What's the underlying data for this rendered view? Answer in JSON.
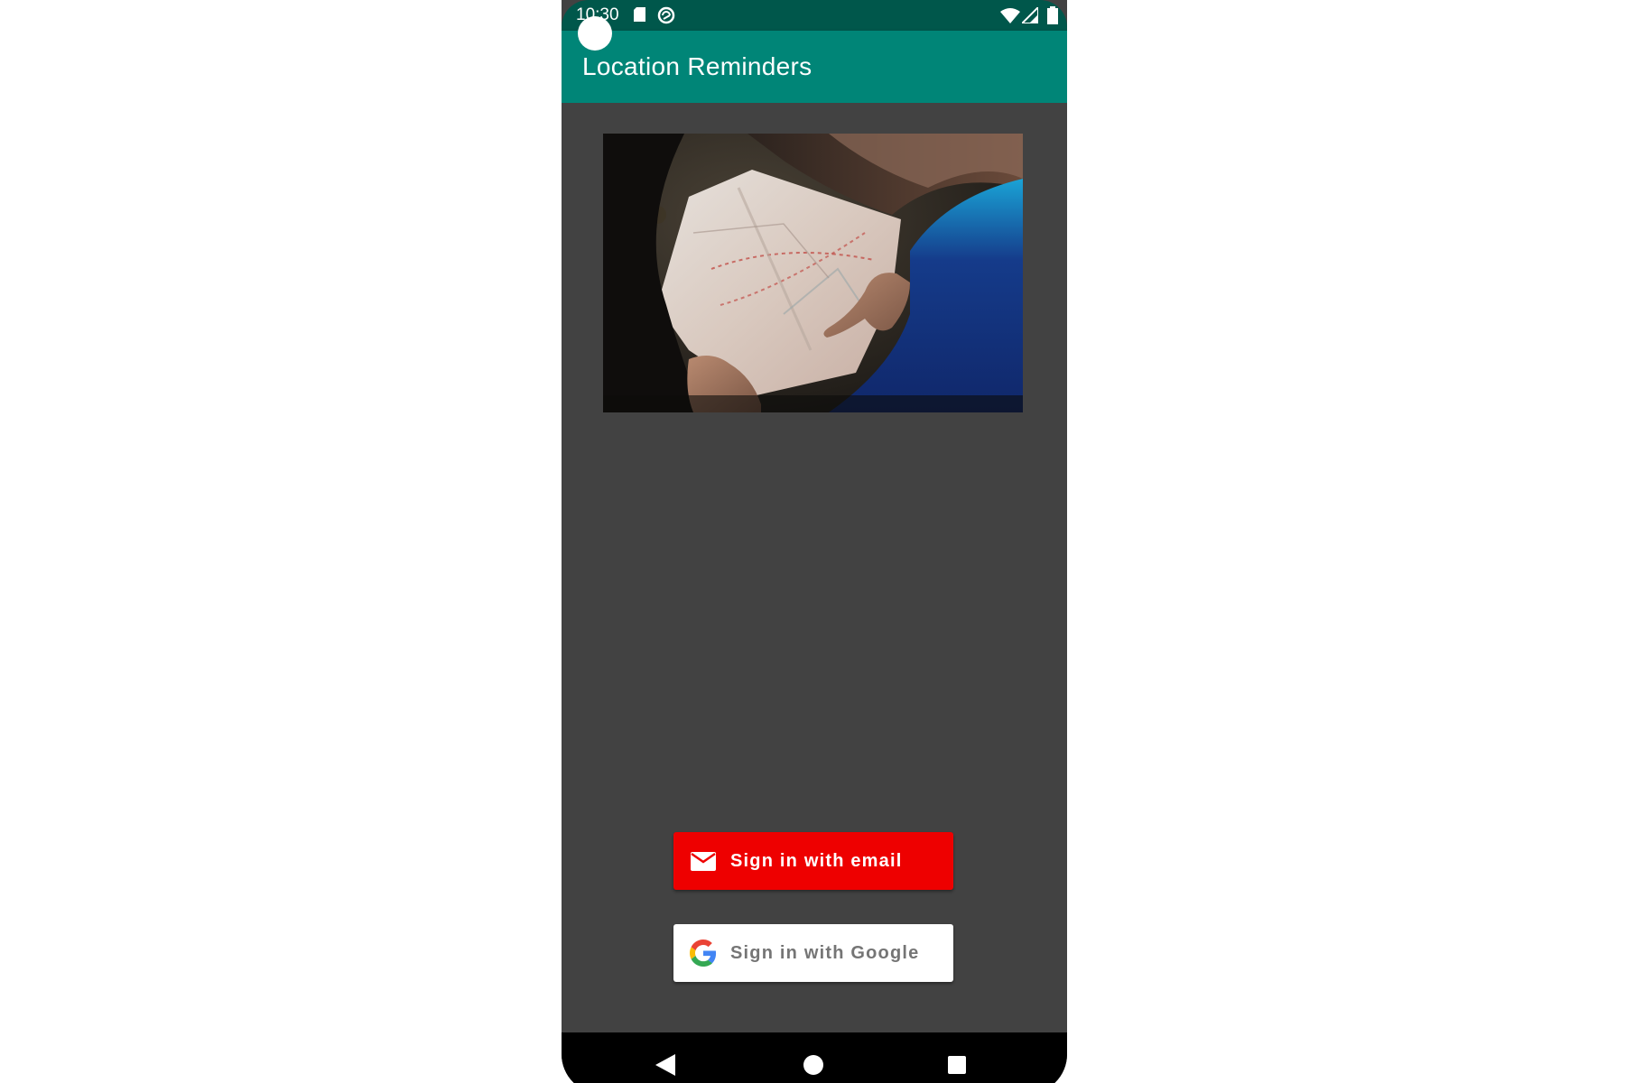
{
  "status_bar": {
    "time": "10:30",
    "icons": [
      "sd-card-icon",
      "sync-icon",
      "wifi-icon",
      "cell-signal-icon",
      "battery-icon"
    ]
  },
  "app_bar": {
    "title": "Location Reminders"
  },
  "hero": {
    "image_description_icon": "map-photo-image"
  },
  "buttons": {
    "email": {
      "label": "Sign in with email",
      "icon": "email-icon",
      "color": "#ee0000"
    },
    "google": {
      "label": "Sign in with Google",
      "icon": "google-icon",
      "color": "#ffffff"
    }
  },
  "navigation_bar": {
    "buttons": [
      "back-icon",
      "home-icon",
      "recents-icon"
    ]
  },
  "colors": {
    "status_bar": "#00574b",
    "app_bar": "#008577",
    "background": "#424242",
    "email_button": "#ee0000",
    "google_button": "#ffffff"
  }
}
